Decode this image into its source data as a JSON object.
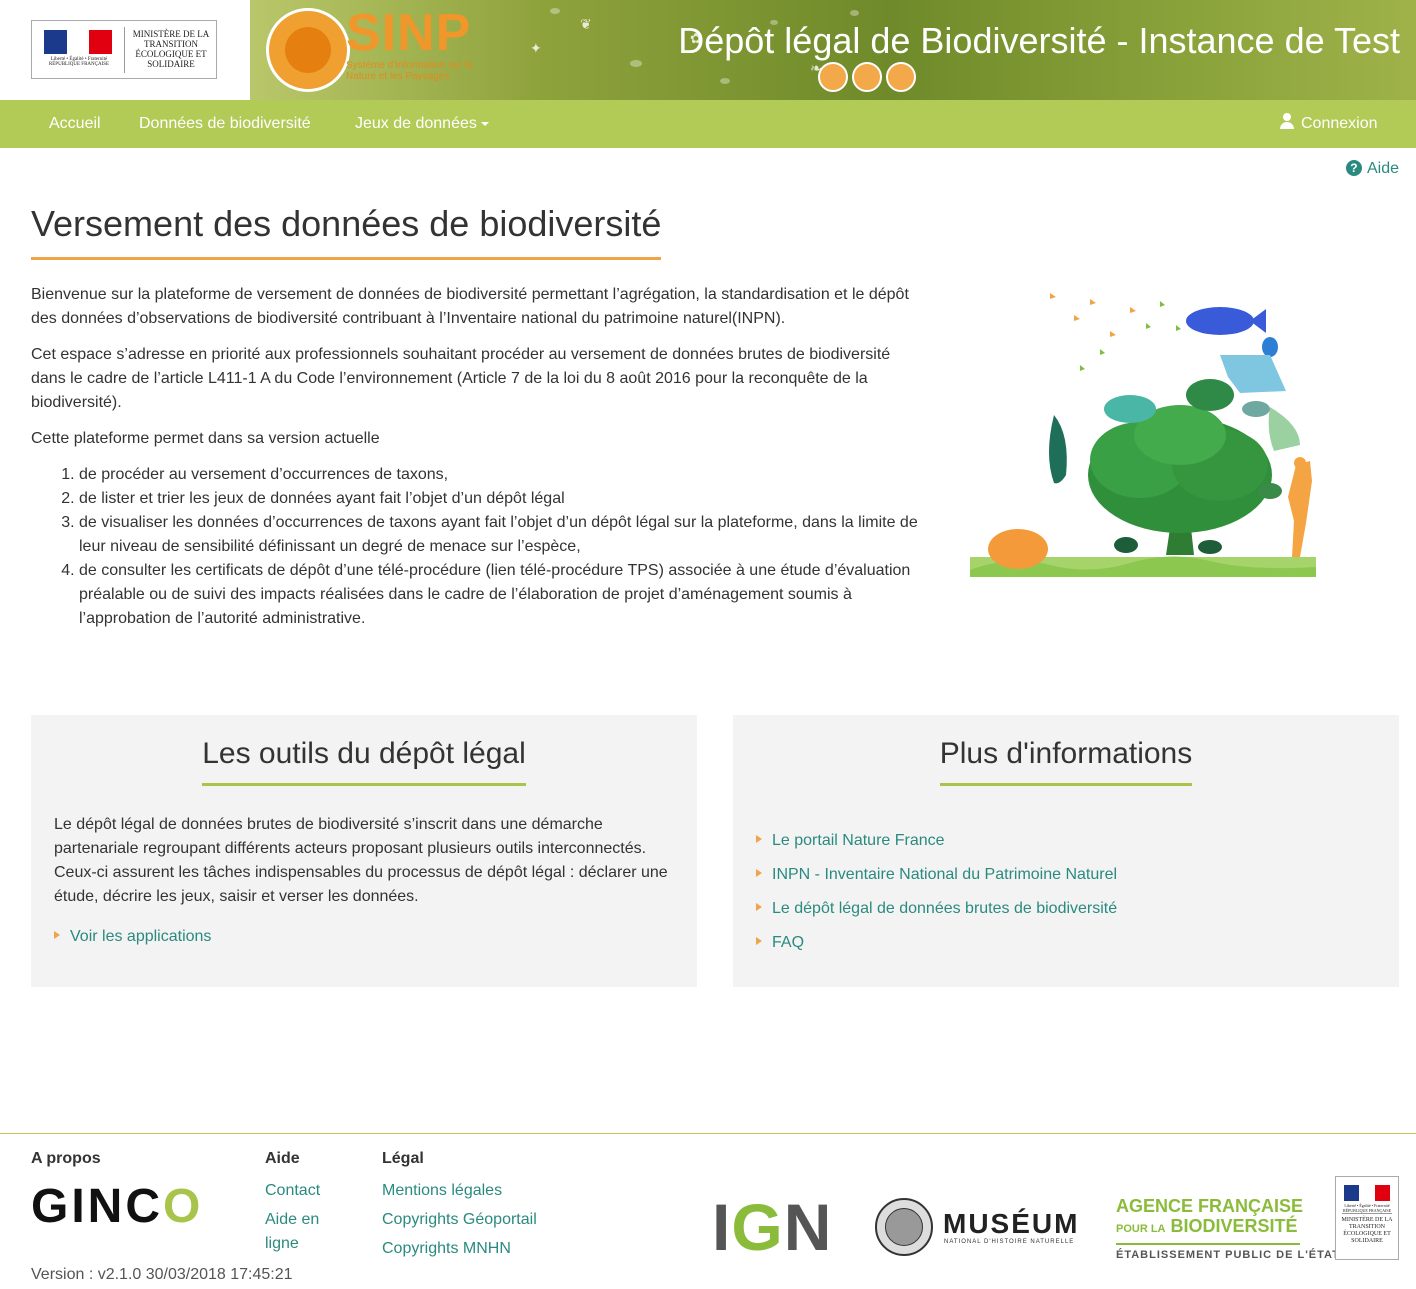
{
  "header": {
    "ministry_lines": "MINISTÈRE DE LA TRANSITION ÉCOLOGIQUE ET SOLIDAIRE",
    "flag_caption": "Liberté • Égalité • Fraternité  RÉPUBLIQUE FRANÇAISE",
    "sinp_logo_text": "SINP",
    "sinp_subtitle": "Système d'Information sur la Nature et les Paysages",
    "title": "Dépôt légal de Biodiversité - Instance de Test",
    "colors": {
      "nav": "#b1cb56",
      "accent_orange": "#f0a44a",
      "accent_green": "#a9c44a",
      "link": "#2a8a80"
    }
  },
  "nav": {
    "home": "Accueil",
    "data": "Données de biodiversité",
    "datasets": "Jeux de données",
    "login": "Connexion",
    "login_icon": "user-icon",
    "datasets_icon": "caret-down-icon"
  },
  "help_link": {
    "label": "Aide",
    "icon": "question-circle-icon"
  },
  "main": {
    "title": "Versement des données de biodiversité",
    "p1": "Bienvenue sur la plateforme de versement de données de biodiversité permettant l’agrégation, la standardisation et le dépôt des données d’observations de biodiversité contribuant à l’Inventaire national du patrimoine naturel(INPN).",
    "p2": "Cet espace s’adresse en priorité aux professionnels souhaitant procéder au versement de données brutes de biodiversité dans le cadre de l’article L411-1 A du Code l’environnement (Article 7 de la loi du 8 août 2016 pour la reconquête de la biodiversité).",
    "p3": "Cette plateforme permet dans sa version actuelle",
    "list": [
      "de procéder au versement d’occurrences de taxons,",
      "de lister et trier les jeux de données ayant fait l’objet d’un dépôt légal",
      "de visualiser les données d’occurrences de taxons ayant fait l’objet d’un dépôt légal sur la plateforme, dans la limite de leur niveau de sensibilité définissant un degré de menace sur l’espèce,",
      "de consulter les certificats de dépôt d’une télé-procédure (lien télé-procédure TPS) associée à une étude d’évaluation préalable ou de suivi des impacts réalisées dans le cadre de l’élaboration de projet d’aménagement soumis à l’approbation de l’autorité administrative."
    ]
  },
  "panel_tools": {
    "title": "Les outils du dépôt légal",
    "text": "Le dépôt légal de données brutes de biodiversité s’inscrit dans une démarche partenariale regroupant différents acteurs proposant plusieurs outils interconnectés. Ceux-ci assurent les tâches indispensables du processus de dépôt légal : déclarer une étude, décrire les jeux, saisir et verser les données.",
    "link": "Voir les applications"
  },
  "panel_info": {
    "title": "Plus d'informations",
    "links": [
      "Le portail Nature France",
      "INPN - Inventaire National du Patrimoine Naturel",
      "Le dépôt légal de données brutes de biodiversité",
      "FAQ"
    ]
  },
  "footer": {
    "about_heading": "A propos",
    "ginco_logo": "GINCO",
    "version": "Version : v2.1.0 30/03/2018 17:45:21",
    "help_heading": "Aide",
    "help_links": [
      "Contact",
      "Aide en",
      "ligne"
    ],
    "legal_heading": "Légal",
    "legal_links": [
      "Mentions légales",
      "Copyrights Géoportail",
      "Copyrights MNHN"
    ],
    "ign_logo": "IGN",
    "museum_logo": "MUSÉUM",
    "museum_sub": "NATIONAL D'HISTOIRE NATURELLE",
    "afb_line1": "AGENCE FRANÇAISE",
    "afb_line2_small": "POUR LA",
    "afb_line2": "BIODIVERSITÉ",
    "afb_line3": "ÉTABLISSEMENT PUBLIC DE L'ÉTAT",
    "rf_text": "MINISTÈRE DE LA TRANSITION ÉCOLOGIQUE ET SOLIDAIRE"
  }
}
